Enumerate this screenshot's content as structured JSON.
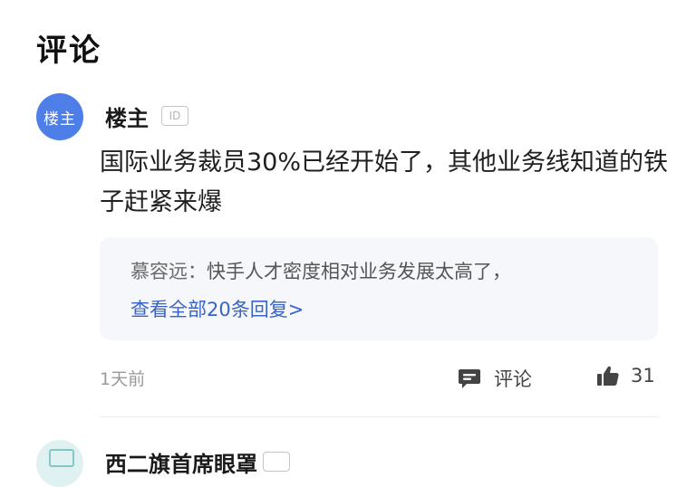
{
  "section": {
    "title": "评论"
  },
  "comments": [
    {
      "avatar_text": "楼主",
      "username": "楼主",
      "id_badge": "ID",
      "text": "国际业务裁员30%已经开始了，其他业务线知道的铁子赶紧来爆",
      "reply_preview": {
        "author": "慕容远：",
        "text": "快手人才密度相对业务发展太高了，"
      },
      "view_all_replies": "查看全部20条回复>",
      "time": "1天前",
      "actions": {
        "comment_label": "评论",
        "comment_icon": "comment-icon",
        "like_icon": "thumbs-up-icon",
        "like_count": "31"
      }
    },
    {
      "username": "西二旗首席眼罩",
      "avatar_icon": "avatar-image"
    }
  ],
  "colors": {
    "accent_link": "#3a63c7",
    "avatar_blue": "#4e7fe8",
    "reply_bg": "#f5f7fa"
  }
}
